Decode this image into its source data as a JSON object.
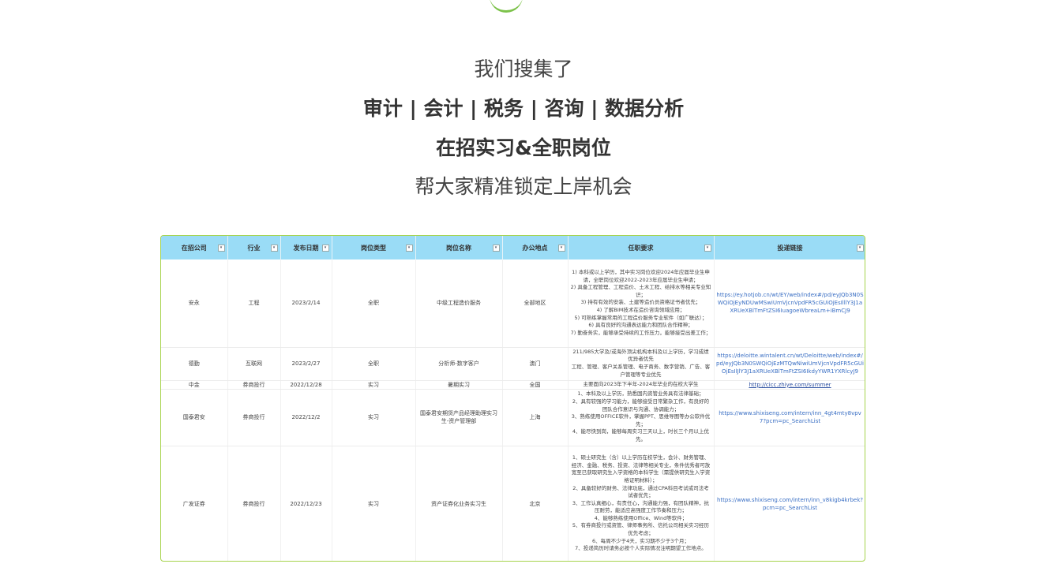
{
  "hero": {
    "line1": "我们搜集了",
    "line2": "审计 | 会计 | 税务 | 咨询 | 数据分析",
    "line3": "在招实习&全职岗位",
    "line4": "帮大家精准锁定上岸机会"
  },
  "table": {
    "headers": [
      "在招公司",
      "行业",
      "发布日期",
      "岗位类型",
      "岗位名称",
      "办公地点",
      "任职要求",
      "投递链接"
    ],
    "rows": [
      {
        "company": "安永",
        "industry": "工程",
        "date": "2023/2/14",
        "type": "全职",
        "title": "中级工程造价服务",
        "location": "全部地区",
        "requirements": [
          "1) 本科或以上学历，其中实习岗位欢迎2024年应届毕业生申请，全职岗位欢迎2022-2023年应届毕业生申请；",
          "2) 具备工程管理、工程造价、土木工程、给排水等相关专业知识；",
          "3) 持有有效的安装、土建等造价员资格证书者优先；",
          "4) 了解BIM技术在造价咨询领域应用；",
          "5) 可熟练掌握常用的工程造价服务专业软件（如广联达）；",
          "6) 具有良好的沟通表达能力和团队合作精神；",
          "7) 勤奋务实，能够承受持续的工作压力，能够接受出差工作；"
        ],
        "link": "https://ey.hotjob.cn/wt/EY/web/index#/pd/eyJQb3N0SWQiOjEyNDUwMSwiUmVjcnVpdFR5cGUiOjEsIlllY3J1aXRUeXBlTmFtZSI6IuagoeWbreaLm+iBmCJ9",
        "link_underline": false
      },
      {
        "company": "德勤",
        "industry": "互联网",
        "date": "2023/2/27",
        "type": "全职",
        "title": "分析师-数字客户",
        "location": "澳门",
        "requirements": [
          "211/985大学及/或海外顶尖机构本科及以上学历，学习成绩优异者优先",
          "工程、管理、客户关系管理、电子商务、数字营销、广告、客户管理等专业优先"
        ],
        "link": "https://deloitte.wintalent.cn/wt/Deloitte/web/index#/pd/eyJQb3N0SWQiOjEzMTQwNiwiUmVjcnVpdFR5cGUiOjEsIlJlY3J1aXRUeXBlTmFtZSI6IkdyYWR1YXRlcyJ9",
        "link_underline": false
      },
      {
        "company": "中金",
        "industry": "券商投行",
        "date": "2022/12/28",
        "type": "实习",
        "title": "暑期实习",
        "location": "全国",
        "requirements": [
          "主要面向2023年下半年-2024年毕业的在校大学生"
        ],
        "link": "http://cicc.zhiye.com/summer",
        "link_underline": true
      },
      {
        "company": "国泰君安",
        "industry": "券商投行",
        "date": "2022/12/2",
        "type": "实习",
        "title": "国泰君安期货产品经理助理实习生-资产管理部",
        "location": "上海",
        "requirements": [
          "1、本科及以上学历，熟悉国内资管业务具有法律基础；",
          "2、具有较强的学习能力，能够接受日常繁杂工作，有良好的团队合作意识与沟通、协调能力；",
          "3、熟练使用OFFICE软件，掌握PPT、思维导图等办公软件优先；",
          "4、能尽快到岗，能够每周实习三天以上，时长三个月以上优先。"
        ],
        "link": "https://www.shixiseng.com/intern/inn_4gt4mty8vpv7?pcm=pc_SearchList",
        "link_underline": false
      },
      {
        "company": "广发证券",
        "industry": "券商投行",
        "date": "2022/12/23",
        "type": "实习",
        "title": "资产证券化业务实习生",
        "location": "北京",
        "requirements": [
          "1、硕士研究生（含）以上学历在校学生，会计、财务管理、经济、金融、税务、投资、法律等相关专业，条件优秀者可放宽至已获取研究生入学资格的本科学生（需提供研究生入学资格证明材料）；",
          "2、具备较好的财务、法律功底，通过CPA科目考试或司法考试者优先；",
          "3、工作认真细心，有责任心，沟通能力强，有团队精神，抗压耐劳，能适应高强度工作节奏和压力；",
          "4、能够熟练使用Office、Wind等软件；",
          "5、有券商投行或资管、律师事务所、信托公司相关实习经历优先考虑；",
          "6、每周不少于4天，实习期不少于3个月；",
          "7、投递简历时请务必按个人实际情况注明期望工作地点。"
        ],
        "link": "https://www.shixiseng.com/intern/inn_v8kigb4krbek?pcm=pc_SearchList",
        "link_underline": false
      }
    ]
  }
}
